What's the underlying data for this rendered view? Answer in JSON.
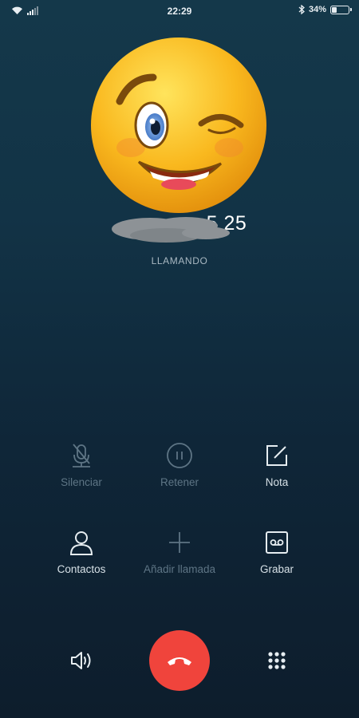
{
  "status_bar": {
    "time": "22:29",
    "battery_percent": "34%",
    "battery_level": 0.34,
    "icons": [
      "wifi-icon",
      "signal-icon",
      "bluetooth-icon",
      "battery-icon"
    ]
  },
  "caller": {
    "number_visible": "5 25",
    "status": "LLAMANDO",
    "avatar": "winking-smiley"
  },
  "controls": {
    "mute": {
      "label": "Silenciar",
      "icon": "mic-off-icon",
      "enabled": false
    },
    "hold": {
      "label": "Retener",
      "icon": "pause-icon",
      "enabled": false
    },
    "note": {
      "label": "Nota",
      "icon": "note-icon",
      "enabled": true
    },
    "contacts": {
      "label": "Contactos",
      "icon": "person-icon",
      "enabled": true
    },
    "add_call": {
      "label": "Añadir llamada",
      "icon": "plus-icon",
      "enabled": false
    },
    "record": {
      "label": "Grabar",
      "icon": "record-icon",
      "enabled": true
    }
  },
  "bottom_bar": {
    "speaker": "speaker-icon",
    "end_call": "end-call-icon",
    "dialpad": "dialpad-icon"
  },
  "colors": {
    "end_call": "#f0443c",
    "enabled_text": "#d6e0e6",
    "disabled_text": "#5e7585"
  }
}
